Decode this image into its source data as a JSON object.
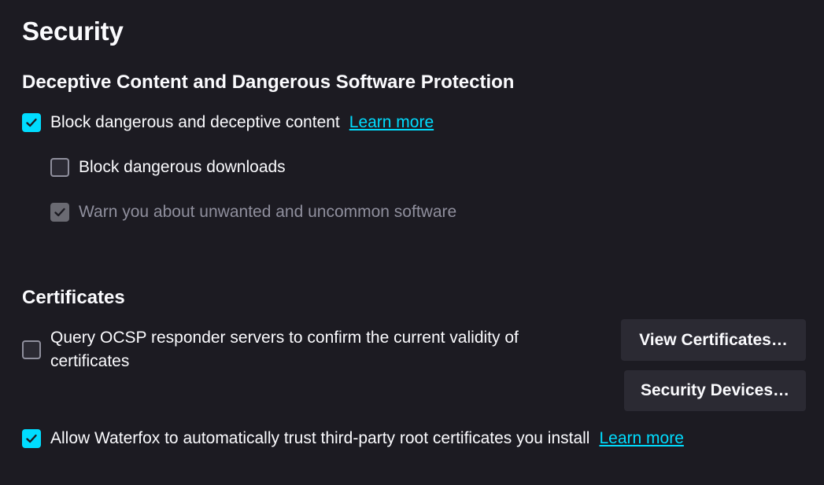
{
  "page": {
    "title": "Security"
  },
  "deceptive": {
    "heading": "Deceptive Content and Dangerous Software Protection",
    "block_deceptive": {
      "label": "Block dangerous and deceptive content",
      "checked": true,
      "learn_more": "Learn more"
    },
    "block_downloads": {
      "label": "Block dangerous downloads",
      "checked": false
    },
    "warn_unwanted": {
      "label": "Warn you about unwanted and uncommon software",
      "checked": true,
      "disabled": true
    }
  },
  "certificates": {
    "heading": "Certificates",
    "ocsp": {
      "label": "Query OCSP responder servers to confirm the current validity of certificates",
      "checked": false
    },
    "view_certificates_button": "View Certificates…",
    "security_devices_button": "Security Devices…",
    "trust_third_party": {
      "label": "Allow Waterfox to automatically trust third-party root certificates you install",
      "checked": true,
      "learn_more": "Learn more"
    }
  },
  "colors": {
    "background": "#1c1b22",
    "accent": "#00ddff",
    "button_bg": "#2b2a33",
    "text": "#fbfbfe",
    "disabled_text": "#8f8f9d"
  },
  "icons": {
    "checkmark": "checkmark-icon"
  }
}
